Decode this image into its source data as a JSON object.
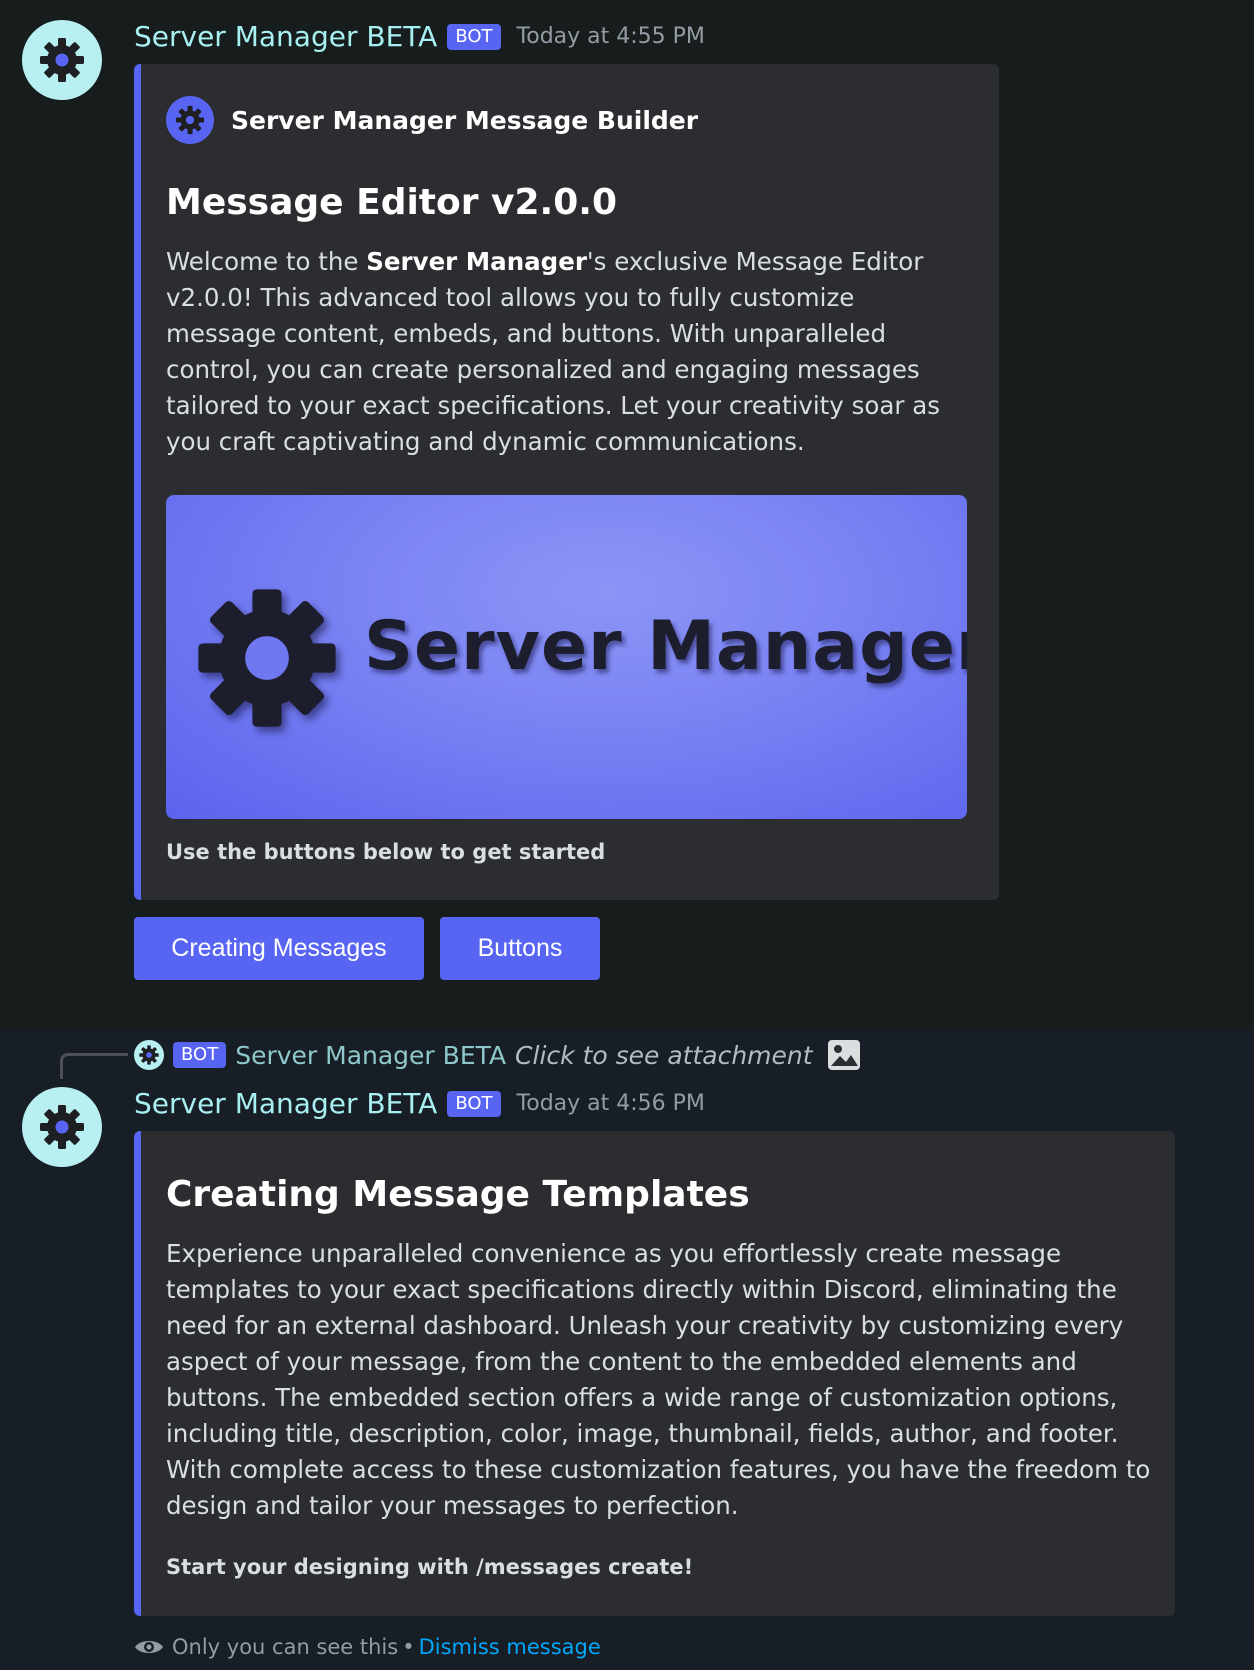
{
  "colors": {
    "accent": "#5865f2",
    "username": "#a8eff2",
    "embed_bg": "#2b2d31",
    "link": "#00a8fc"
  },
  "message1": {
    "username": "Server Manager BETA",
    "bot_tag": "BOT",
    "timestamp": "Today at 4:55 PM",
    "embed": {
      "author": "Server Manager Message Builder",
      "title": "Message Editor v2.0.0",
      "desc_prefix": "Welcome to the ",
      "desc_bold": "Server Manager",
      "desc_rest": "'s exclusive Message Editor v2.0.0! This advanced tool allows you to fully customize message content, embeds, and buttons. With unparalleled control, you can create personalized and engaging messages tailored to your exact specifications. Let your creativity soar as you craft captivating and dynamic communications.",
      "image_text": "Server Manager",
      "footer": "Use the buttons below to get started"
    },
    "buttons": {
      "creating_messages": "Creating Messages",
      "buttons": "Buttons"
    }
  },
  "reply": {
    "bot_tag": "BOT",
    "username": "Server Manager BETA",
    "text": "Click to see attachment",
    "icon": "image-icon"
  },
  "message2": {
    "username": "Server Manager BETA",
    "bot_tag": "BOT",
    "timestamp": "Today at 4:56 PM",
    "embed": {
      "title": "Creating Message Templates",
      "description": "Experience unparalleled convenience as you effortlessly create message templates to your exact specifications directly within Discord, eliminating the need for an external dashboard. Unleash your creativity by customizing every aspect of your message, from the content to the embedded elements and buttons. The embedded section offers a wide range of customization options, including title, description, color, image, thumbnail, fields, author, and footer. With complete access to these customization features, you have the freedom to design and tailor your messages to perfection.",
      "footer": "Start your designing with /messages create!"
    },
    "ephemeral": {
      "notice": "Only you can see this",
      "separator": "•",
      "dismiss": "Dismiss message"
    }
  }
}
